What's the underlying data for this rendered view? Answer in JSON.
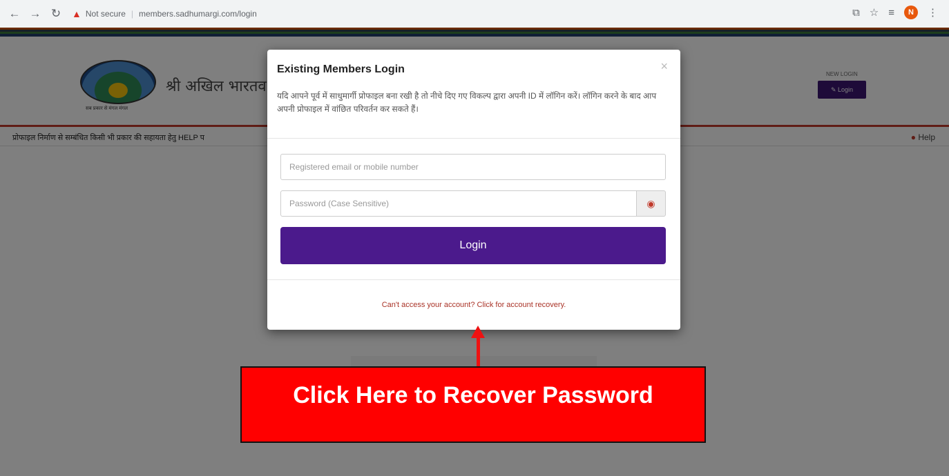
{
  "browser": {
    "back_icon": "arrow-left-icon",
    "forward_icon": "arrow-right-icon",
    "reload_icon": "reload-icon",
    "security_warning": "Not secure",
    "url": "members.sadhumargi.com/login",
    "profile_initial": "N"
  },
  "site": {
    "title": "श्री अखिल भारतव",
    "logo_tagline": "सब प्रकार से मंगल मंगल",
    "header_login_label": "NEW LOGIN",
    "header_login_button": "✎ Login",
    "notice": "प्रोफाइल निर्माण से सम्बंधित किसी भी प्रकार की सहायता हेतु HELP प",
    "help": "Help"
  },
  "modal": {
    "title": "Existing Members Login",
    "close": "×",
    "description": "यदि आपने पूर्व में साधुमार्गी प्रोफाइल बना रखी है तो नीचे दिए गए विकल्प द्वारा अपनी ID में लॉगिन करें। लॉगिन करने के बाद आप अपनी प्रोफाइल में वांछित परिवर्तन कर सकते हैं।",
    "email_placeholder": "Registered email or mobile number",
    "password_placeholder": "Password (Case Sensitive)",
    "login_button": "Login",
    "recovery_link": "Can't access your account? Click for account recovery."
  },
  "annotation": {
    "callout_text": "Click Here to Recover Password"
  },
  "colors": {
    "login_button": "#4b1a8c",
    "callout": "#ff0000",
    "recovery_link": "#a93226"
  }
}
